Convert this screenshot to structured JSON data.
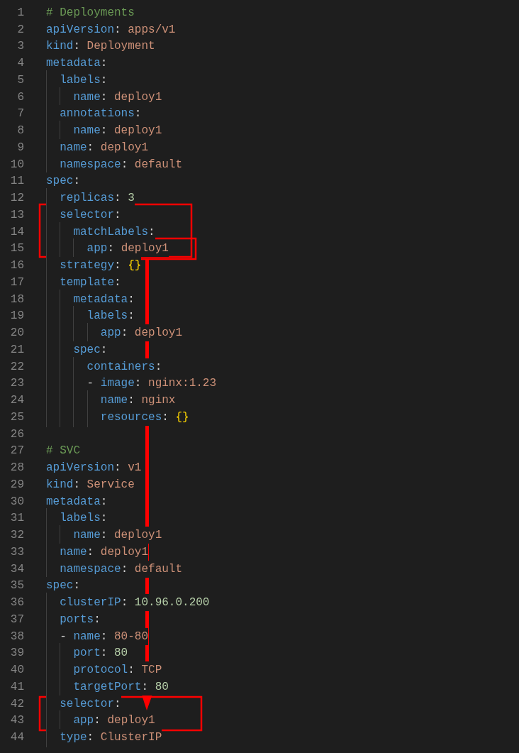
{
  "editor": {
    "lines": [
      {
        "number": "1",
        "tokens": [
          {
            "kind": "comment",
            "text": "# Deployments"
          }
        ]
      },
      {
        "number": "2",
        "tokens": [
          {
            "kind": "key",
            "text": "apiVersion"
          },
          {
            "kind": "punct",
            "text": ": "
          },
          {
            "kind": "string",
            "text": "apps/v1"
          }
        ]
      },
      {
        "number": "3",
        "tokens": [
          {
            "kind": "key",
            "text": "kind"
          },
          {
            "kind": "punct",
            "text": ": "
          },
          {
            "kind": "string",
            "text": "Deployment"
          }
        ]
      },
      {
        "number": "4",
        "tokens": [
          {
            "kind": "key",
            "text": "metadata"
          },
          {
            "kind": "punct",
            "text": ":"
          }
        ]
      },
      {
        "number": "5",
        "tokens": [
          {
            "kind": "key",
            "text": "  labels"
          },
          {
            "kind": "punct",
            "text": ":"
          }
        ]
      },
      {
        "number": "6",
        "tokens": [
          {
            "kind": "key",
            "text": "    name"
          },
          {
            "kind": "punct",
            "text": ": "
          },
          {
            "kind": "string",
            "text": "deploy1"
          }
        ]
      },
      {
        "number": "7",
        "tokens": [
          {
            "kind": "key",
            "text": "  annotations"
          },
          {
            "kind": "punct",
            "text": ":"
          }
        ]
      },
      {
        "number": "8",
        "tokens": [
          {
            "kind": "key",
            "text": "    name"
          },
          {
            "kind": "punct",
            "text": ": "
          },
          {
            "kind": "string",
            "text": "deploy1"
          }
        ]
      },
      {
        "number": "9",
        "tokens": [
          {
            "kind": "key",
            "text": "  name"
          },
          {
            "kind": "punct",
            "text": ": "
          },
          {
            "kind": "string",
            "text": "deploy1"
          }
        ]
      },
      {
        "number": "10",
        "tokens": [
          {
            "kind": "key",
            "text": "  namespace"
          },
          {
            "kind": "punct",
            "text": ": "
          },
          {
            "kind": "string",
            "text": "default"
          }
        ]
      },
      {
        "number": "11",
        "tokens": [
          {
            "kind": "key",
            "text": "spec"
          },
          {
            "kind": "punct",
            "text": ":"
          }
        ]
      },
      {
        "number": "12",
        "tokens": [
          {
            "kind": "key",
            "text": "  replicas"
          },
          {
            "kind": "punct",
            "text": ": "
          },
          {
            "kind": "number",
            "text": "3"
          }
        ]
      },
      {
        "number": "13",
        "tokens": [
          {
            "kind": "key",
            "text": "  selector"
          },
          {
            "kind": "punct",
            "text": ":"
          }
        ]
      },
      {
        "number": "14",
        "tokens": [
          {
            "kind": "key",
            "text": "    matchLabels"
          },
          {
            "kind": "punct",
            "text": ":"
          }
        ]
      },
      {
        "number": "15",
        "tokens": [
          {
            "kind": "key",
            "text": "      app"
          },
          {
            "kind": "punct",
            "text": ": "
          },
          {
            "kind": "string",
            "text": "deploy1"
          }
        ]
      },
      {
        "number": "16",
        "tokens": [
          {
            "kind": "key",
            "text": "  strategy"
          },
          {
            "kind": "punct",
            "text": ": "
          },
          {
            "kind": "brace",
            "text": "{}"
          }
        ]
      },
      {
        "number": "17",
        "tokens": [
          {
            "kind": "key",
            "text": "  template"
          },
          {
            "kind": "punct",
            "text": ":"
          }
        ]
      },
      {
        "number": "18",
        "tokens": [
          {
            "kind": "key",
            "text": "    metadata"
          },
          {
            "kind": "punct",
            "text": ":"
          }
        ]
      },
      {
        "number": "19",
        "tokens": [
          {
            "kind": "key",
            "text": "      labels"
          },
          {
            "kind": "punct",
            "text": ":"
          }
        ]
      },
      {
        "number": "20",
        "tokens": [
          {
            "kind": "key",
            "text": "        app"
          },
          {
            "kind": "punct",
            "text": ": "
          },
          {
            "kind": "string",
            "text": "deploy1"
          }
        ]
      },
      {
        "number": "21",
        "tokens": [
          {
            "kind": "key",
            "text": "    spec"
          },
          {
            "kind": "punct",
            "text": ":"
          }
        ]
      },
      {
        "number": "22",
        "tokens": [
          {
            "kind": "key",
            "text": "      containers"
          },
          {
            "kind": "punct",
            "text": ":"
          }
        ]
      },
      {
        "number": "23",
        "tokens": [
          {
            "kind": "punct",
            "text": "      - "
          },
          {
            "kind": "key",
            "text": "image"
          },
          {
            "kind": "punct",
            "text": ": "
          },
          {
            "kind": "string",
            "text": "nginx:1.23"
          }
        ]
      },
      {
        "number": "24",
        "tokens": [
          {
            "kind": "key",
            "text": "        name"
          },
          {
            "kind": "punct",
            "text": ": "
          },
          {
            "kind": "string",
            "text": "nginx"
          }
        ]
      },
      {
        "number": "25",
        "tokens": [
          {
            "kind": "key",
            "text": "        resources"
          },
          {
            "kind": "punct",
            "text": ": "
          },
          {
            "kind": "brace",
            "text": "{}"
          }
        ]
      },
      {
        "number": "26"
      },
      {
        "number": "27",
        "tokens": [
          {
            "kind": "comment",
            "text": "# SVC"
          }
        ]
      },
      {
        "number": "28",
        "tokens": [
          {
            "kind": "key",
            "text": "apiVersion"
          },
          {
            "kind": "punct",
            "text": ": "
          },
          {
            "kind": "string",
            "text": "v1"
          }
        ]
      },
      {
        "number": "29",
        "tokens": [
          {
            "kind": "key",
            "text": "kind"
          },
          {
            "kind": "punct",
            "text": ": "
          },
          {
            "kind": "string",
            "text": "Service"
          }
        ]
      },
      {
        "number": "30",
        "tokens": [
          {
            "kind": "key",
            "text": "metadata"
          },
          {
            "kind": "punct",
            "text": ":"
          }
        ]
      },
      {
        "number": "31",
        "tokens": [
          {
            "kind": "key",
            "text": "  labels"
          },
          {
            "kind": "punct",
            "text": ":"
          }
        ]
      },
      {
        "number": "32",
        "tokens": [
          {
            "kind": "key",
            "text": "    name"
          },
          {
            "kind": "punct",
            "text": ": "
          },
          {
            "kind": "string",
            "text": "deploy1"
          }
        ]
      },
      {
        "number": "33",
        "tokens": [
          {
            "kind": "key",
            "text": "  name"
          },
          {
            "kind": "punct",
            "text": ": "
          },
          {
            "kind": "string",
            "text": "deploy1"
          }
        ]
      },
      {
        "number": "34",
        "tokens": [
          {
            "kind": "key",
            "text": "  namespace"
          },
          {
            "kind": "punct",
            "text": ": "
          },
          {
            "kind": "string",
            "text": "default"
          }
        ]
      },
      {
        "number": "35",
        "tokens": [
          {
            "kind": "key",
            "text": "spec"
          },
          {
            "kind": "punct",
            "text": ":"
          }
        ]
      },
      {
        "number": "36",
        "tokens": [
          {
            "kind": "key",
            "text": "  clusterIP"
          },
          {
            "kind": "punct",
            "text": ": "
          },
          {
            "kind": "number",
            "text": "10.96.0.200"
          }
        ]
      },
      {
        "number": "37",
        "tokens": [
          {
            "kind": "key",
            "text": "  ports"
          },
          {
            "kind": "punct",
            "text": ":"
          }
        ]
      },
      {
        "number": "38",
        "tokens": [
          {
            "kind": "punct",
            "text": "  - "
          },
          {
            "kind": "key",
            "text": "name"
          },
          {
            "kind": "punct",
            "text": ": "
          },
          {
            "kind": "string",
            "text": "80-80"
          }
        ]
      },
      {
        "number": "39",
        "tokens": [
          {
            "kind": "key",
            "text": "    port"
          },
          {
            "kind": "punct",
            "text": ": "
          },
          {
            "kind": "number",
            "text": "80"
          }
        ]
      },
      {
        "number": "40",
        "tokens": [
          {
            "kind": "key",
            "text": "    protocol"
          },
          {
            "kind": "punct",
            "text": ": "
          },
          {
            "kind": "string",
            "text": "TCP"
          }
        ]
      },
      {
        "number": "41",
        "tokens": [
          {
            "kind": "key",
            "text": "    targetPort"
          },
          {
            "kind": "punct",
            "text": ": "
          },
          {
            "kind": "number",
            "text": "80"
          }
        ]
      },
      {
        "number": "42",
        "tokens": [
          {
            "kind": "key",
            "text": "  selector"
          },
          {
            "kind": "punct",
            "text": ":"
          }
        ]
      },
      {
        "number": "43",
        "tokens": [
          {
            "kind": "key",
            "text": "    app"
          },
          {
            "kind": "punct",
            "text": ": "
          },
          {
            "kind": "string",
            "text": "deploy1"
          }
        ]
      },
      {
        "number": "44",
        "tokens": [
          {
            "kind": "key",
            "text": "  type"
          },
          {
            "kind": "punct",
            "text": ": "
          },
          {
            "kind": "string",
            "text": "ClusterIP"
          }
        ]
      }
    ]
  }
}
